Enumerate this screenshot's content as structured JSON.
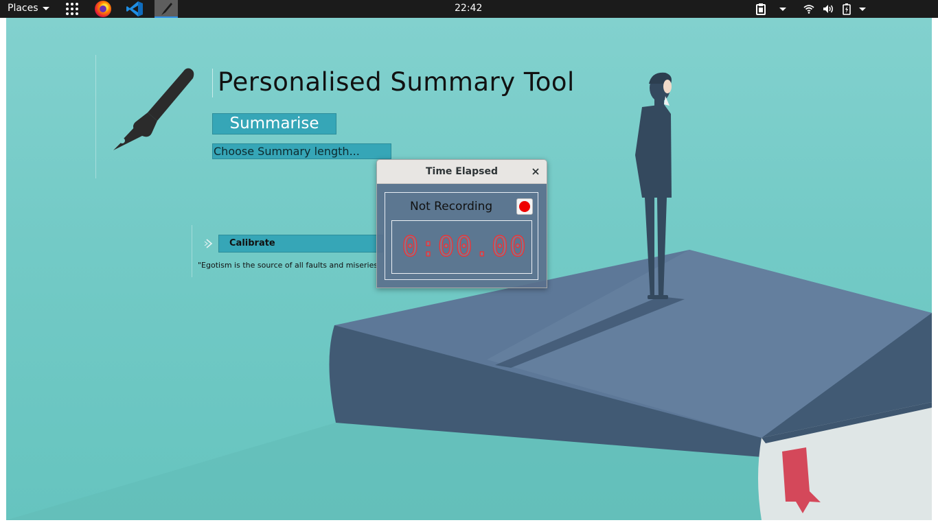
{
  "panel": {
    "places_label": "Places",
    "clock": "22:42",
    "apps": [
      {
        "name": "firefox-icon"
      },
      {
        "name": "vscode-icon"
      },
      {
        "name": "summary-tool-icon"
      }
    ],
    "tray_icons": [
      "clipboard-icon",
      "wifi-icon",
      "volume-icon",
      "battery-icon"
    ]
  },
  "app": {
    "title": "Personalised Summary Tool",
    "summarise_label": "Summarise",
    "length_placeholder": "Choose Summary length...",
    "calibrate_label": "Calibrate",
    "quote": "\"Egotism is the source of all faults and miseries"
  },
  "dialog": {
    "title": "Time Elapsed",
    "status": "Not Recording",
    "timer": "0:00.00"
  },
  "colors": {
    "accent": "#36a6b7",
    "desktop": "#73cac6",
    "record": "#ee0000",
    "timer_digits": "#ff2a2a"
  }
}
